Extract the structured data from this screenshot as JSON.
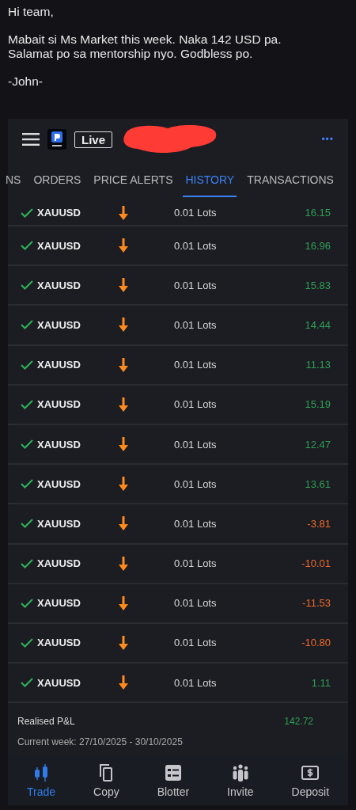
{
  "message": {
    "lines": [
      "Hi team,",
      "Mabait si Ms Market this week. Naka 142 USD pa.\nSalamat po sa mentorship nyo. Godbless po.",
      "-John-"
    ]
  },
  "header": {
    "badge": "Live",
    "menu_glyph": "•••"
  },
  "tabs": [
    {
      "label": "NS",
      "selected": false
    },
    {
      "label": "ORDERS",
      "selected": false
    },
    {
      "label": "PRICE ALERTS",
      "selected": false
    },
    {
      "label": "HISTORY",
      "selected": true
    },
    {
      "label": "TRANSACTIONS",
      "selected": false
    }
  ],
  "rows": [
    {
      "symbol": "XAUUSD",
      "kind": "sell",
      "lots": "0.01 Lots",
      "pnl": "16.15",
      "color": "#2f9e55",
      "partial": true
    },
    {
      "symbol": "XAUUSD",
      "kind": "sell",
      "lots": "0.01 Lots",
      "pnl": "16.96",
      "color": "#2f9e55",
      "partial": false
    },
    {
      "symbol": "XAUUSD",
      "kind": "sell",
      "lots": "0.01 Lots",
      "pnl": "15.83",
      "color": "#2f9e55",
      "partial": false
    },
    {
      "symbol": "XAUUSD",
      "kind": "sell",
      "lots": "0.01 Lots",
      "pnl": "14.44",
      "color": "#2f9e55",
      "partial": false
    },
    {
      "symbol": "XAUUSD",
      "kind": "sell",
      "lots": "0.01 Lots",
      "pnl": "11.13",
      "color": "#2f9e55",
      "partial": false
    },
    {
      "symbol": "XAUUSD",
      "kind": "sell",
      "lots": "0.01 Lots",
      "pnl": "15.19",
      "color": "#2f9e55",
      "partial": false
    },
    {
      "symbol": "XAUUSD",
      "kind": "sell",
      "lots": "0.01 Lots",
      "pnl": "12.47",
      "color": "#2f9e55",
      "partial": false
    },
    {
      "symbol": "XAUUSD",
      "kind": "sell",
      "lots": "0.01 Lots",
      "pnl": "13.61",
      "color": "#2f9e55",
      "partial": false
    },
    {
      "symbol": "XAUUSD",
      "kind": "sell",
      "lots": "0.01 Lots",
      "pnl": "-3.81",
      "color": "#ef6a2c",
      "partial": false
    },
    {
      "symbol": "XAUUSD",
      "kind": "sell",
      "lots": "0.01 Lots",
      "pnl": "-10.01",
      "color": "#ef6a2c",
      "partial": false
    },
    {
      "symbol": "XAUUSD",
      "kind": "sell",
      "lots": "0.01 Lots",
      "pnl": "-11.53",
      "color": "#ef6a2c",
      "partial": false
    },
    {
      "symbol": "XAUUSD",
      "kind": "sell",
      "lots": "0.01 Lots",
      "pnl": "-10.80",
      "color": "#ef6a2c",
      "partial": false
    },
    {
      "symbol": "XAUUSD",
      "kind": "sell",
      "lots": "0.01 Lots",
      "pnl": "1.11",
      "color": "#2f9e55",
      "partial": false
    }
  ],
  "summary": {
    "label": "Realised P&L",
    "value": "142.72",
    "color": "#2f9e55",
    "period": "Current week: 27/10/2025 - 30/10/2025"
  },
  "nav": [
    {
      "label": "Trade",
      "kind": "candles",
      "selected": true
    },
    {
      "label": "Copy",
      "kind": "copy",
      "selected": false
    },
    {
      "label": "Blotter",
      "kind": "blotter",
      "selected": false
    },
    {
      "label": "Invite",
      "kind": "people",
      "selected": false
    },
    {
      "label": "Deposit",
      "kind": "money",
      "selected": false
    }
  ]
}
